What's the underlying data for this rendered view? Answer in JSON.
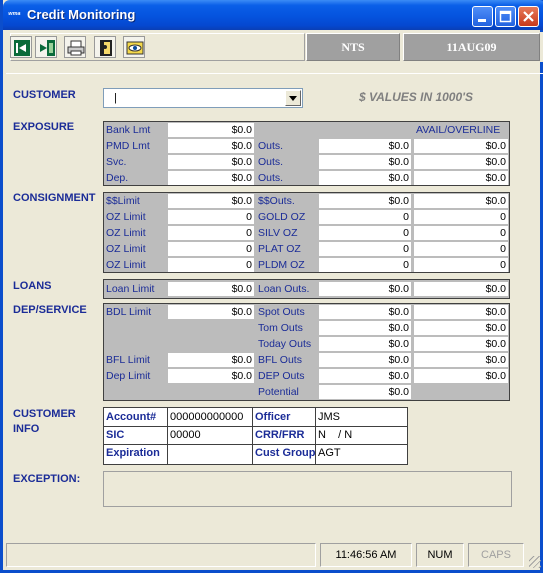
{
  "window": {
    "title": "Credit Monitoring",
    "icon": "app-icon"
  },
  "title_buttons": [
    "minimize-button",
    "maximize-button",
    "close-button"
  ],
  "toolbar": {
    "tools": [
      {
        "name": "back-icon"
      },
      {
        "name": "exit-icon"
      },
      {
        "name": "print-icon"
      },
      {
        "name": "door-icon"
      },
      {
        "name": "eye-icon"
      }
    ],
    "code": "NTS",
    "date": "11AUG09"
  },
  "customer": {
    "label": "CUSTOMER",
    "value": "",
    "note": "$ VALUES IN 1000'S"
  },
  "exposure": {
    "label": "EXPOSURE",
    "header_right": "AVAIL/OVERLINE",
    "rows": [
      {
        "left_label": "Bank Lmt",
        "left_value": "$0.0",
        "mid_label": "",
        "mid_value": "",
        "right_value": ""
      },
      {
        "left_label": "PMD Lmt",
        "left_value": "$0.0",
        "mid_label": "Outs.",
        "mid_value": "$0.0",
        "right_value": "$0.0"
      },
      {
        "left_label": "Svc.",
        "left_value": "$0.0",
        "mid_label": "Outs.",
        "mid_value": "$0.0",
        "right_value": "$0.0"
      },
      {
        "left_label": "Dep.",
        "left_value": "$0.0",
        "mid_label": "Outs.",
        "mid_value": "$0.0",
        "right_value": "$0.0"
      }
    ]
  },
  "consignment": {
    "label": "CONSIGNMENT",
    "rows": [
      {
        "left_label": "$$Limit",
        "left_value": "$0.0",
        "mid_label": "$$Outs.",
        "mid_value": "$0.0",
        "right_value": "$0.0"
      },
      {
        "left_label": "OZ Limit",
        "left_value": "0",
        "mid_label": "GOLD OZ",
        "mid_value": "0",
        "right_value": "0"
      },
      {
        "left_label": "OZ Limit",
        "left_value": "0",
        "mid_label": "SILV OZ",
        "mid_value": "0",
        "right_value": "0"
      },
      {
        "left_label": "OZ Limit",
        "left_value": "0",
        "mid_label": "PLAT OZ",
        "mid_value": "0",
        "right_value": "0"
      },
      {
        "left_label": "OZ Limit",
        "left_value": "0",
        "mid_label": "PLDM OZ",
        "mid_value": "0",
        "right_value": "0"
      }
    ]
  },
  "loans": {
    "label": "LOANS",
    "rows": [
      {
        "left_label": "Loan Limit",
        "left_value": "$0.0",
        "mid_label": "Loan Outs.",
        "mid_value": "$0.0",
        "right_value": "$0.0"
      }
    ]
  },
  "dep_service": {
    "label": "DEP/SERVICE",
    "rows": [
      {
        "left_label": "BDL Limit",
        "left_value": "$0.0",
        "mid_label": "Spot Outs",
        "mid_value": "$0.0",
        "right_value": "$0.0"
      },
      {
        "left_label": "",
        "left_value": "",
        "mid_label": "Tom Outs",
        "mid_value": "$0.0",
        "right_value": "$0.0"
      },
      {
        "left_label": "",
        "left_value": "",
        "mid_label": "Today Outs",
        "mid_value": "$0.0",
        "right_value": "$0.0"
      },
      {
        "left_label": "BFL Limit",
        "left_value": "$0.0",
        "mid_label": "BFL Outs",
        "mid_value": "$0.0",
        "right_value": "$0.0"
      },
      {
        "left_label": "Dep Limit",
        "left_value": "$0.0",
        "mid_label": "DEP Outs",
        "mid_value": "$0.0",
        "right_value": "$0.0"
      },
      {
        "left_label": "",
        "left_value": "",
        "mid_label": "Potential",
        "mid_value": "$0.0",
        "right_value": ""
      }
    ]
  },
  "customer_info": {
    "label1": "CUSTOMER",
    "label2": "INFO",
    "account_label": "Account#",
    "account_value": "000000000000",
    "officer_label": "Officer",
    "officer_value": "JMS",
    "sic_label": "SIC",
    "sic_value": "00000",
    "crr_label": "CRR/FRR",
    "crr_value": "N    / N",
    "exp_label": "Expiration",
    "exp_value": "",
    "cust_group_label": "Cust Group",
    "cust_group_value": "AGT"
  },
  "exception": {
    "label": "EXCEPTION:",
    "value": ""
  },
  "statusbar": {
    "time": "11:46:56 AM",
    "num": "NUM",
    "caps": "CAPS"
  }
}
